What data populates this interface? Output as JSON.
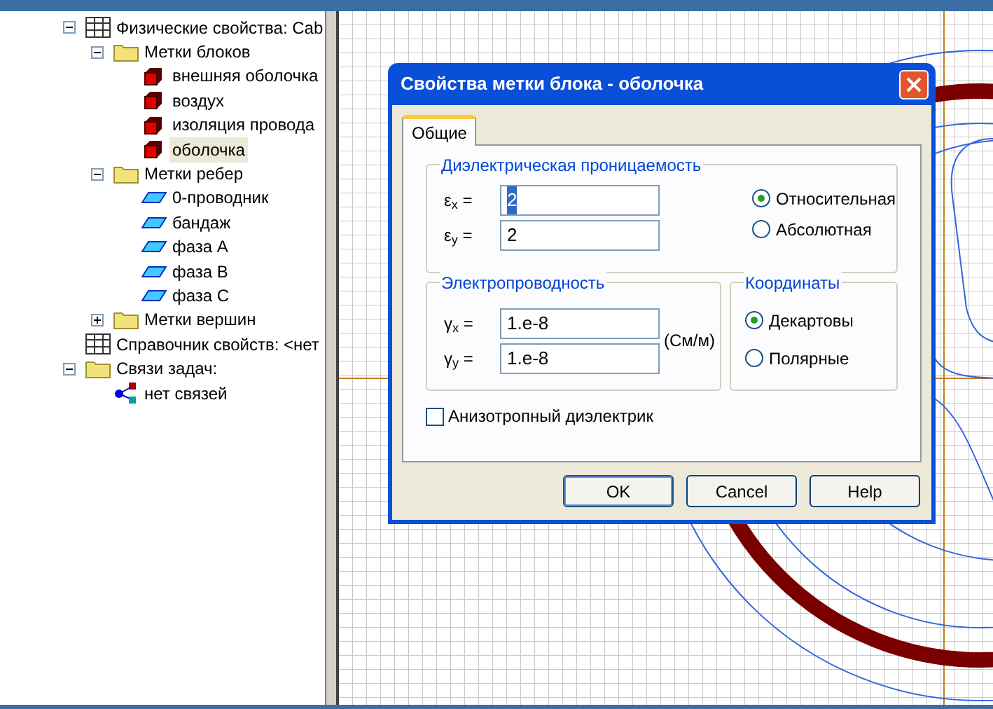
{
  "tree": [
    {
      "label": "Физические свойства: Cab",
      "kind": "table",
      "expanded": true,
      "selected": false,
      "children": [
        {
          "label": "Метки блоков",
          "kind": "folder",
          "expanded": true,
          "selected": false,
          "children": [
            {
              "label": "внешняя оболочка",
              "kind": "block",
              "selected": false
            },
            {
              "label": "воздух",
              "kind": "block",
              "selected": false
            },
            {
              "label": "изоляция провода",
              "kind": "block",
              "selected": false
            },
            {
              "label": "оболочка",
              "kind": "block",
              "selected": true
            }
          ]
        },
        {
          "label": "Метки ребер",
          "kind": "folder",
          "expanded": true,
          "selected": false,
          "children": [
            {
              "label": "0-проводник",
              "kind": "edge",
              "selected": false
            },
            {
              "label": "бандаж",
              "kind": "edge",
              "selected": false
            },
            {
              "label": "фаза A",
              "kind": "edge",
              "selected": false
            },
            {
              "label": "фаза B",
              "kind": "edge",
              "selected": false
            },
            {
              "label": "фаза C",
              "kind": "edge",
              "selected": false
            }
          ]
        },
        {
          "label": "Метки вершин",
          "kind": "folder",
          "expanded": false,
          "selected": false
        }
      ]
    },
    {
      "label": "Справочник свойств: <нет",
      "kind": "table",
      "selected": false
    },
    {
      "label": "Связи задач:",
      "kind": "folder",
      "expanded": true,
      "selected": false,
      "children": [
        {
          "label": "нет связей",
          "kind": "link",
          "selected": false
        }
      ]
    }
  ],
  "dialog": {
    "title": "Свойства метки блока - оболочка",
    "tabs": [
      {
        "label": "Общие",
        "selected": true
      }
    ],
    "permittivity": {
      "title": "Диэлектрическая проницаемость",
      "fields": [
        {
          "label": "ε$_{x}$ =",
          "value": "2",
          "text_selected": true
        },
        {
          "label": "ε$_{y}$ =",
          "value": "2",
          "text_selected": false
        }
      ],
      "options": [
        {
          "label": "Относительная",
          "selected": true
        },
        {
          "label": "Абсолютная",
          "selected": false
        }
      ]
    },
    "conductivity": {
      "title": "Электропроводность",
      "fields": [
        {
          "label": "γ$_{x}$ =",
          "value": "1.e-8"
        },
        {
          "label": "γ$_{y}$ =",
          "value": "1.e-8"
        }
      ],
      "unit": "(См/м)"
    },
    "coordinates": {
      "title": "Координаты",
      "options": [
        {
          "label": "Декартовы",
          "selected": true
        },
        {
          "label": "Полярные",
          "selected": false
        }
      ]
    },
    "anisotropic": {
      "label": "Анизотропный диэлектрик",
      "checked": false
    },
    "buttons": [
      {
        "label": "OK",
        "default": true
      },
      {
        "label": "Cancel",
        "default": false
      },
      {
        "label": "Help",
        "default": false
      }
    ]
  }
}
